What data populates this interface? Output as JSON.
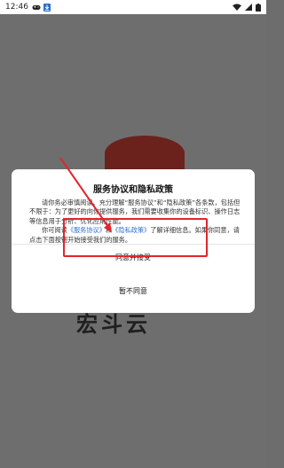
{
  "status_bar": {
    "time": "12:46",
    "icons_left": [
      "gamepad-icon",
      "download-icon"
    ],
    "icons_right": [
      "wifi-icon",
      "signal-icon",
      "battery-icon"
    ]
  },
  "dialog": {
    "title": "服务协议和隐私政策",
    "paragraph1": "请你务必审慎阅读、充分理解“服务协议”和“隐私政策”各条款，包括但不限于：为了更好的向你提供服务，我们需要收集你的设备标识、操作日志等信息用于分析、优化应用性能。",
    "p2_prefix": "你可阅读",
    "link_service": "《服务协议》",
    "p2_and": "和",
    "link_privacy": "《隐私政策》",
    "p2_suffix": "了解详细信息。如果你同意，请点击下面按钮开始接受我们的服务。",
    "agree_button": "同意并接受",
    "disagree_button": "暂不同意"
  },
  "background": {
    "logo_text": "宏斗云"
  },
  "colors": {
    "highlight": "#e0262c",
    "link": "#2f6fd6",
    "overlay": "#6e6e6e"
  }
}
